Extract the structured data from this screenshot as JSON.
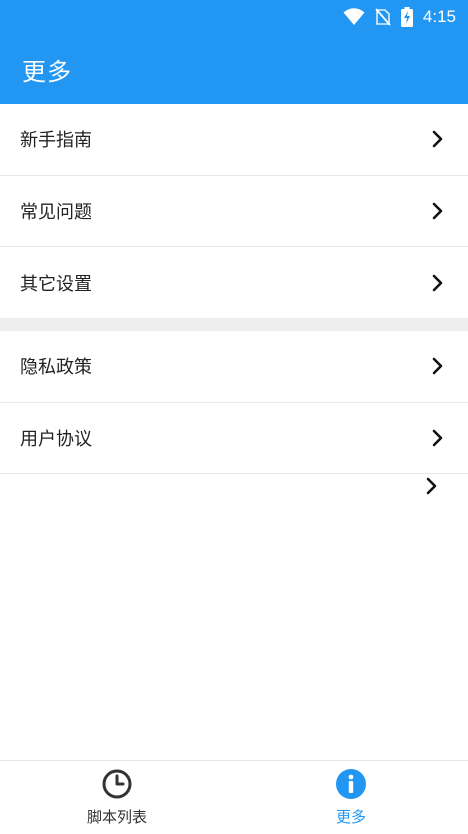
{
  "status_bar": {
    "time": "4:15",
    "icons": [
      "wifi-icon",
      "no-sim-icon",
      "battery-charging-icon"
    ]
  },
  "app_bar": {
    "title": "更多"
  },
  "menu": {
    "group1": [
      {
        "label": "新手指南"
      },
      {
        "label": "常见问题"
      },
      {
        "label": "其它设置"
      }
    ],
    "group2": [
      {
        "label": "隐私政策"
      },
      {
        "label": "用户协议"
      }
    ]
  },
  "bottom_nav": {
    "tabs": [
      {
        "label": "脚本列表",
        "icon": "clock-icon",
        "active": false
      },
      {
        "label": "更多",
        "icon": "info-icon",
        "active": true
      }
    ]
  },
  "colors": {
    "primary": "#2196F3",
    "separator": "#eeeeee",
    "text": "#222222"
  }
}
